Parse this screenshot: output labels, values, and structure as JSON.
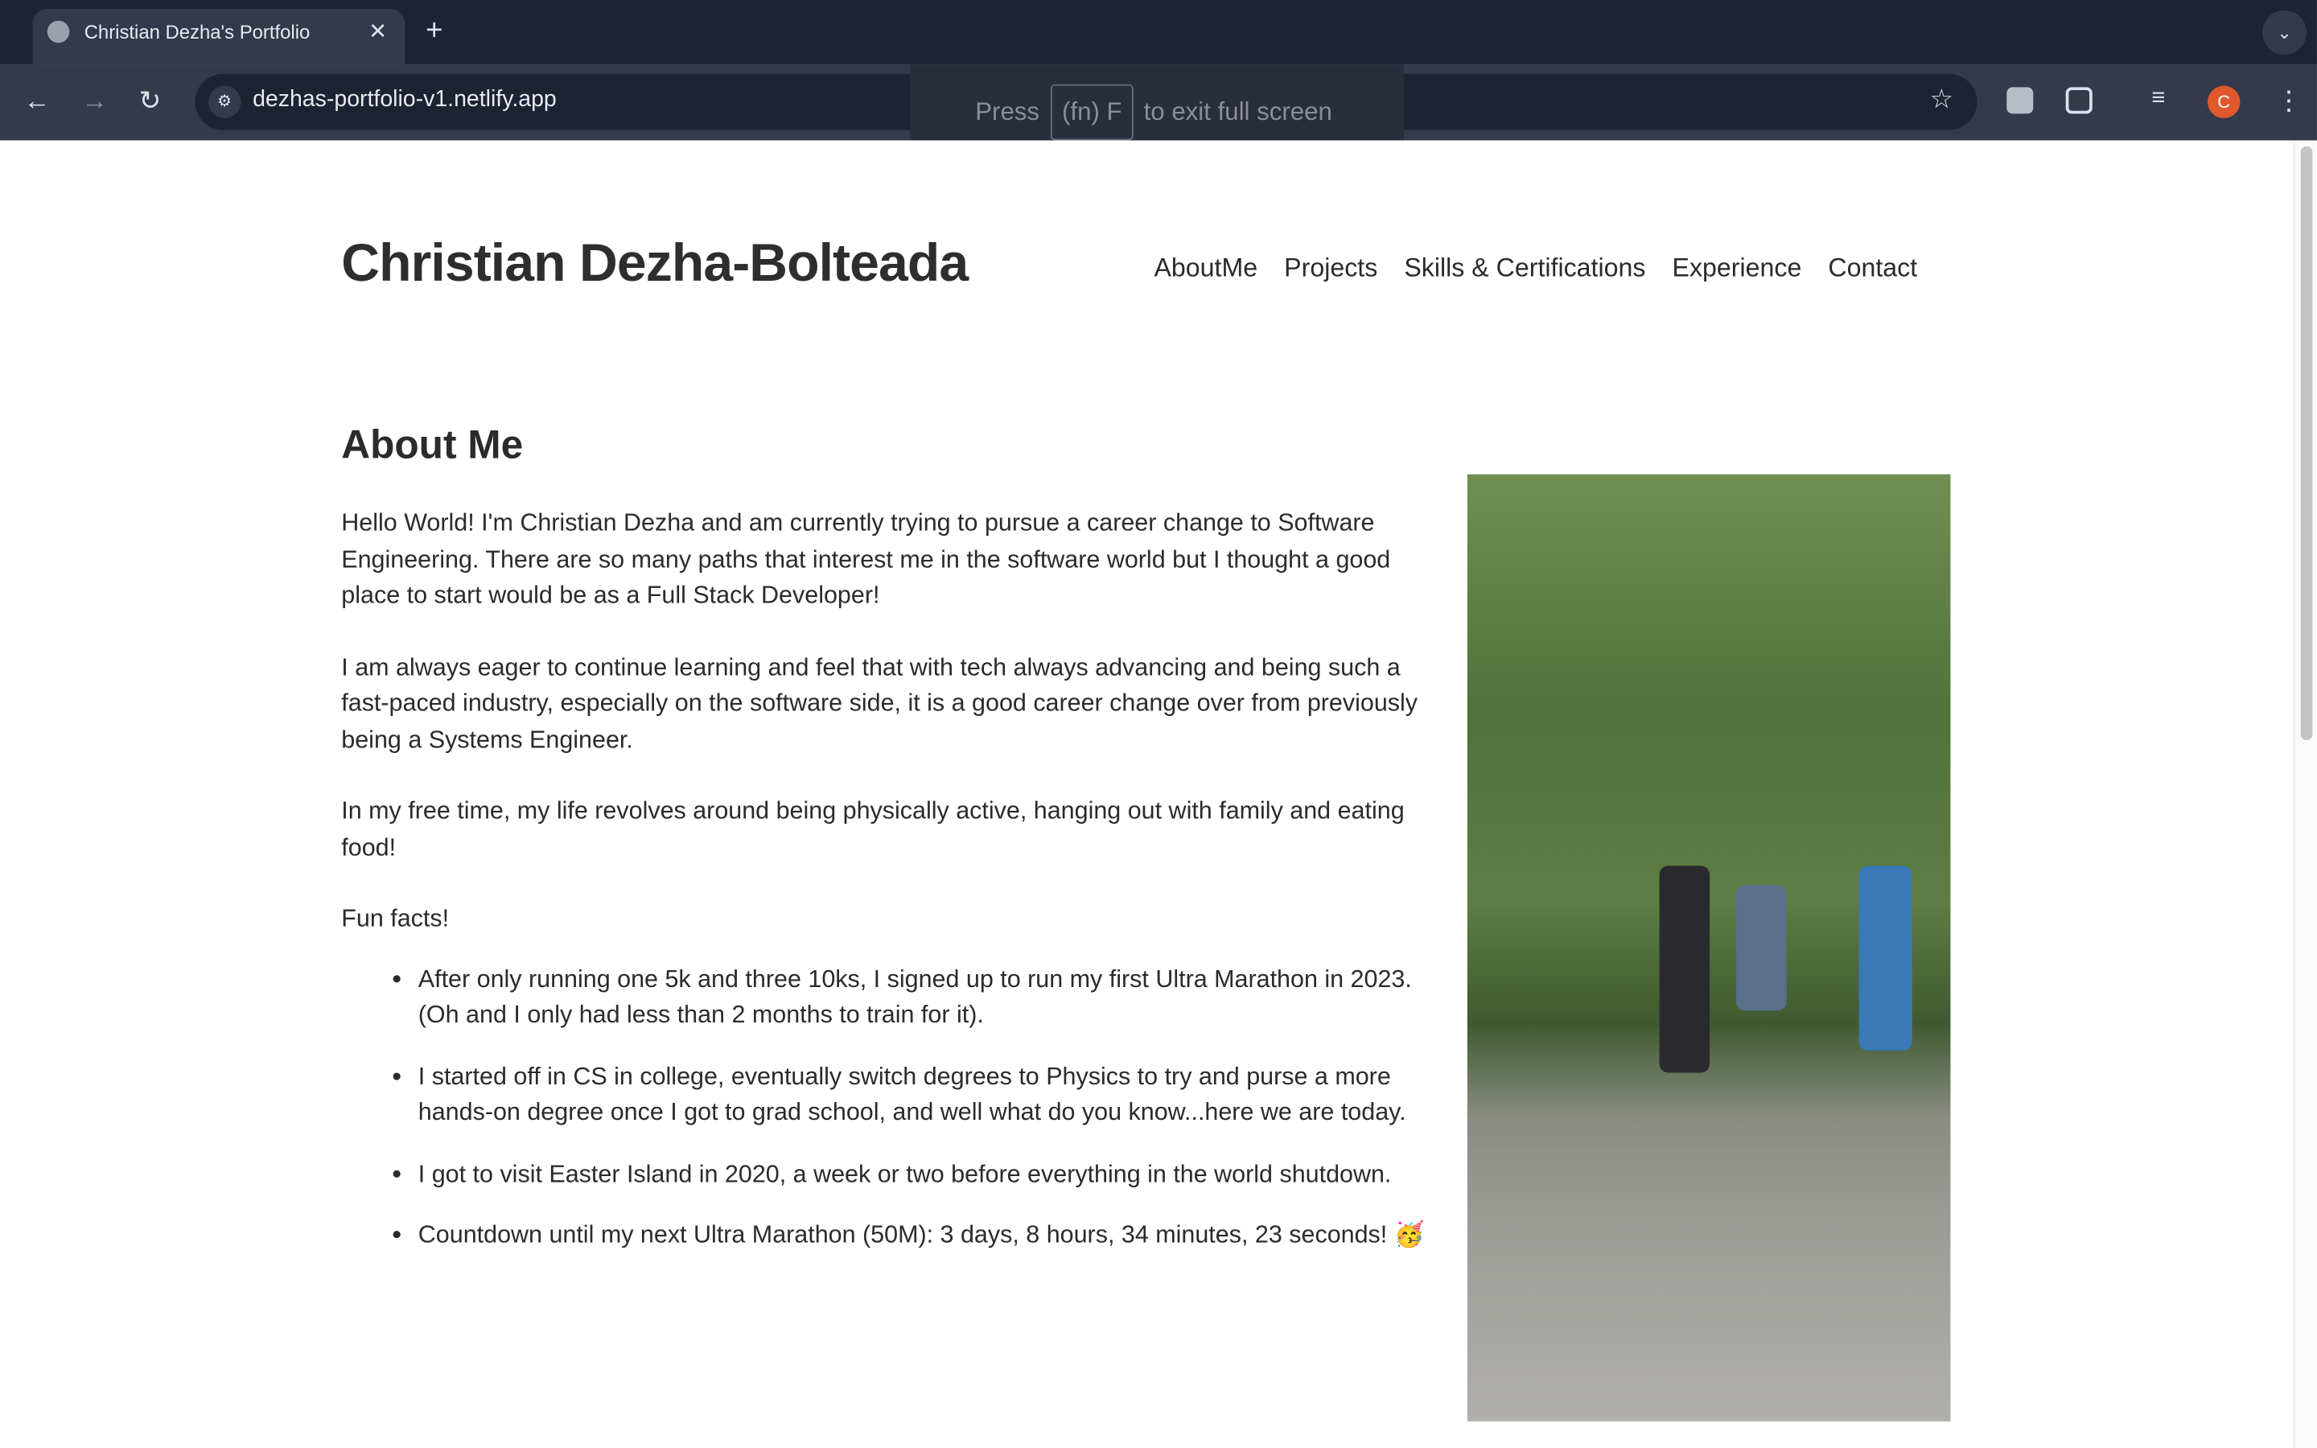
{
  "browser": {
    "tab_title": "Christian Dezha's Portfolio",
    "url": "dezhas-portfolio-v1.netlify.app",
    "fullscreen_notice": {
      "before": "Press",
      "key": "(fn) F",
      "after": "to exit full screen"
    },
    "profile_initial": "C",
    "accent": "#e0582b"
  },
  "header": {
    "name": "Christian Dezha-Bolteada",
    "nav": [
      "AboutMe",
      "Projects",
      "Skills & Certifications",
      "Experience",
      "Contact"
    ]
  },
  "about": {
    "heading": "About Me",
    "paragraphs": [
      "Hello World! I'm Christian Dezha and am currently trying to pursue a career change to Software Engineering. There are so many paths that interest me in the software world but I thought a good place to start would be as a Full Stack Developer!",
      "I am always eager to continue learning and feel that with tech always advancing and being such a fast-paced industry, especially on the software side, it is a good career change over from previously being a Systems Engineer.",
      "In my free time, my life revolves around being physically active, hanging out with family and eating food!",
      "Fun facts!"
    ],
    "facts": [
      "After only running one 5k and three 10ks, I signed up to run my first Ultra Marathon in 2023. (Oh and I only had less than 2 months to train for it).",
      "I started off in CS in college, eventually switch degrees to Physics to try and purse a more hands-on degree once I got to grad school, and well what do you know...here we are today.",
      "I got to visit Easter Island in 2020, a week or two before everything in the world shutdown.",
      "Countdown until my next Ultra Marathon (50M): 3 days, 8 hours, 34 minutes, 23 seconds! 🥳"
    ]
  }
}
